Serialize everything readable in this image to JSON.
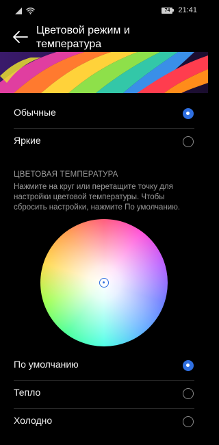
{
  "status_bar": {
    "battery": "74",
    "time": "21:41"
  },
  "header": {
    "title": "Цветовой режим и температура"
  },
  "color_mode": {
    "options": [
      {
        "label": "Обычные",
        "selected": true
      },
      {
        "label": "Яркие",
        "selected": false
      }
    ]
  },
  "temperature": {
    "section_title": "ЦВЕТОВАЯ ТЕМПЕРАТУРА",
    "description": "Нажмите на круг или перетащите точку для настройки цветовой температуры. Чтобы сбросить настройки, нажмите По умолчанию.",
    "options": [
      {
        "label": "По умолчанию",
        "selected": true
      },
      {
        "label": "Тепло",
        "selected": false
      },
      {
        "label": "Холодно",
        "selected": false
      }
    ]
  },
  "colors": {
    "accent": "#2f6fe0",
    "background": "#000000",
    "text_secondary": "#9a9a9a"
  }
}
